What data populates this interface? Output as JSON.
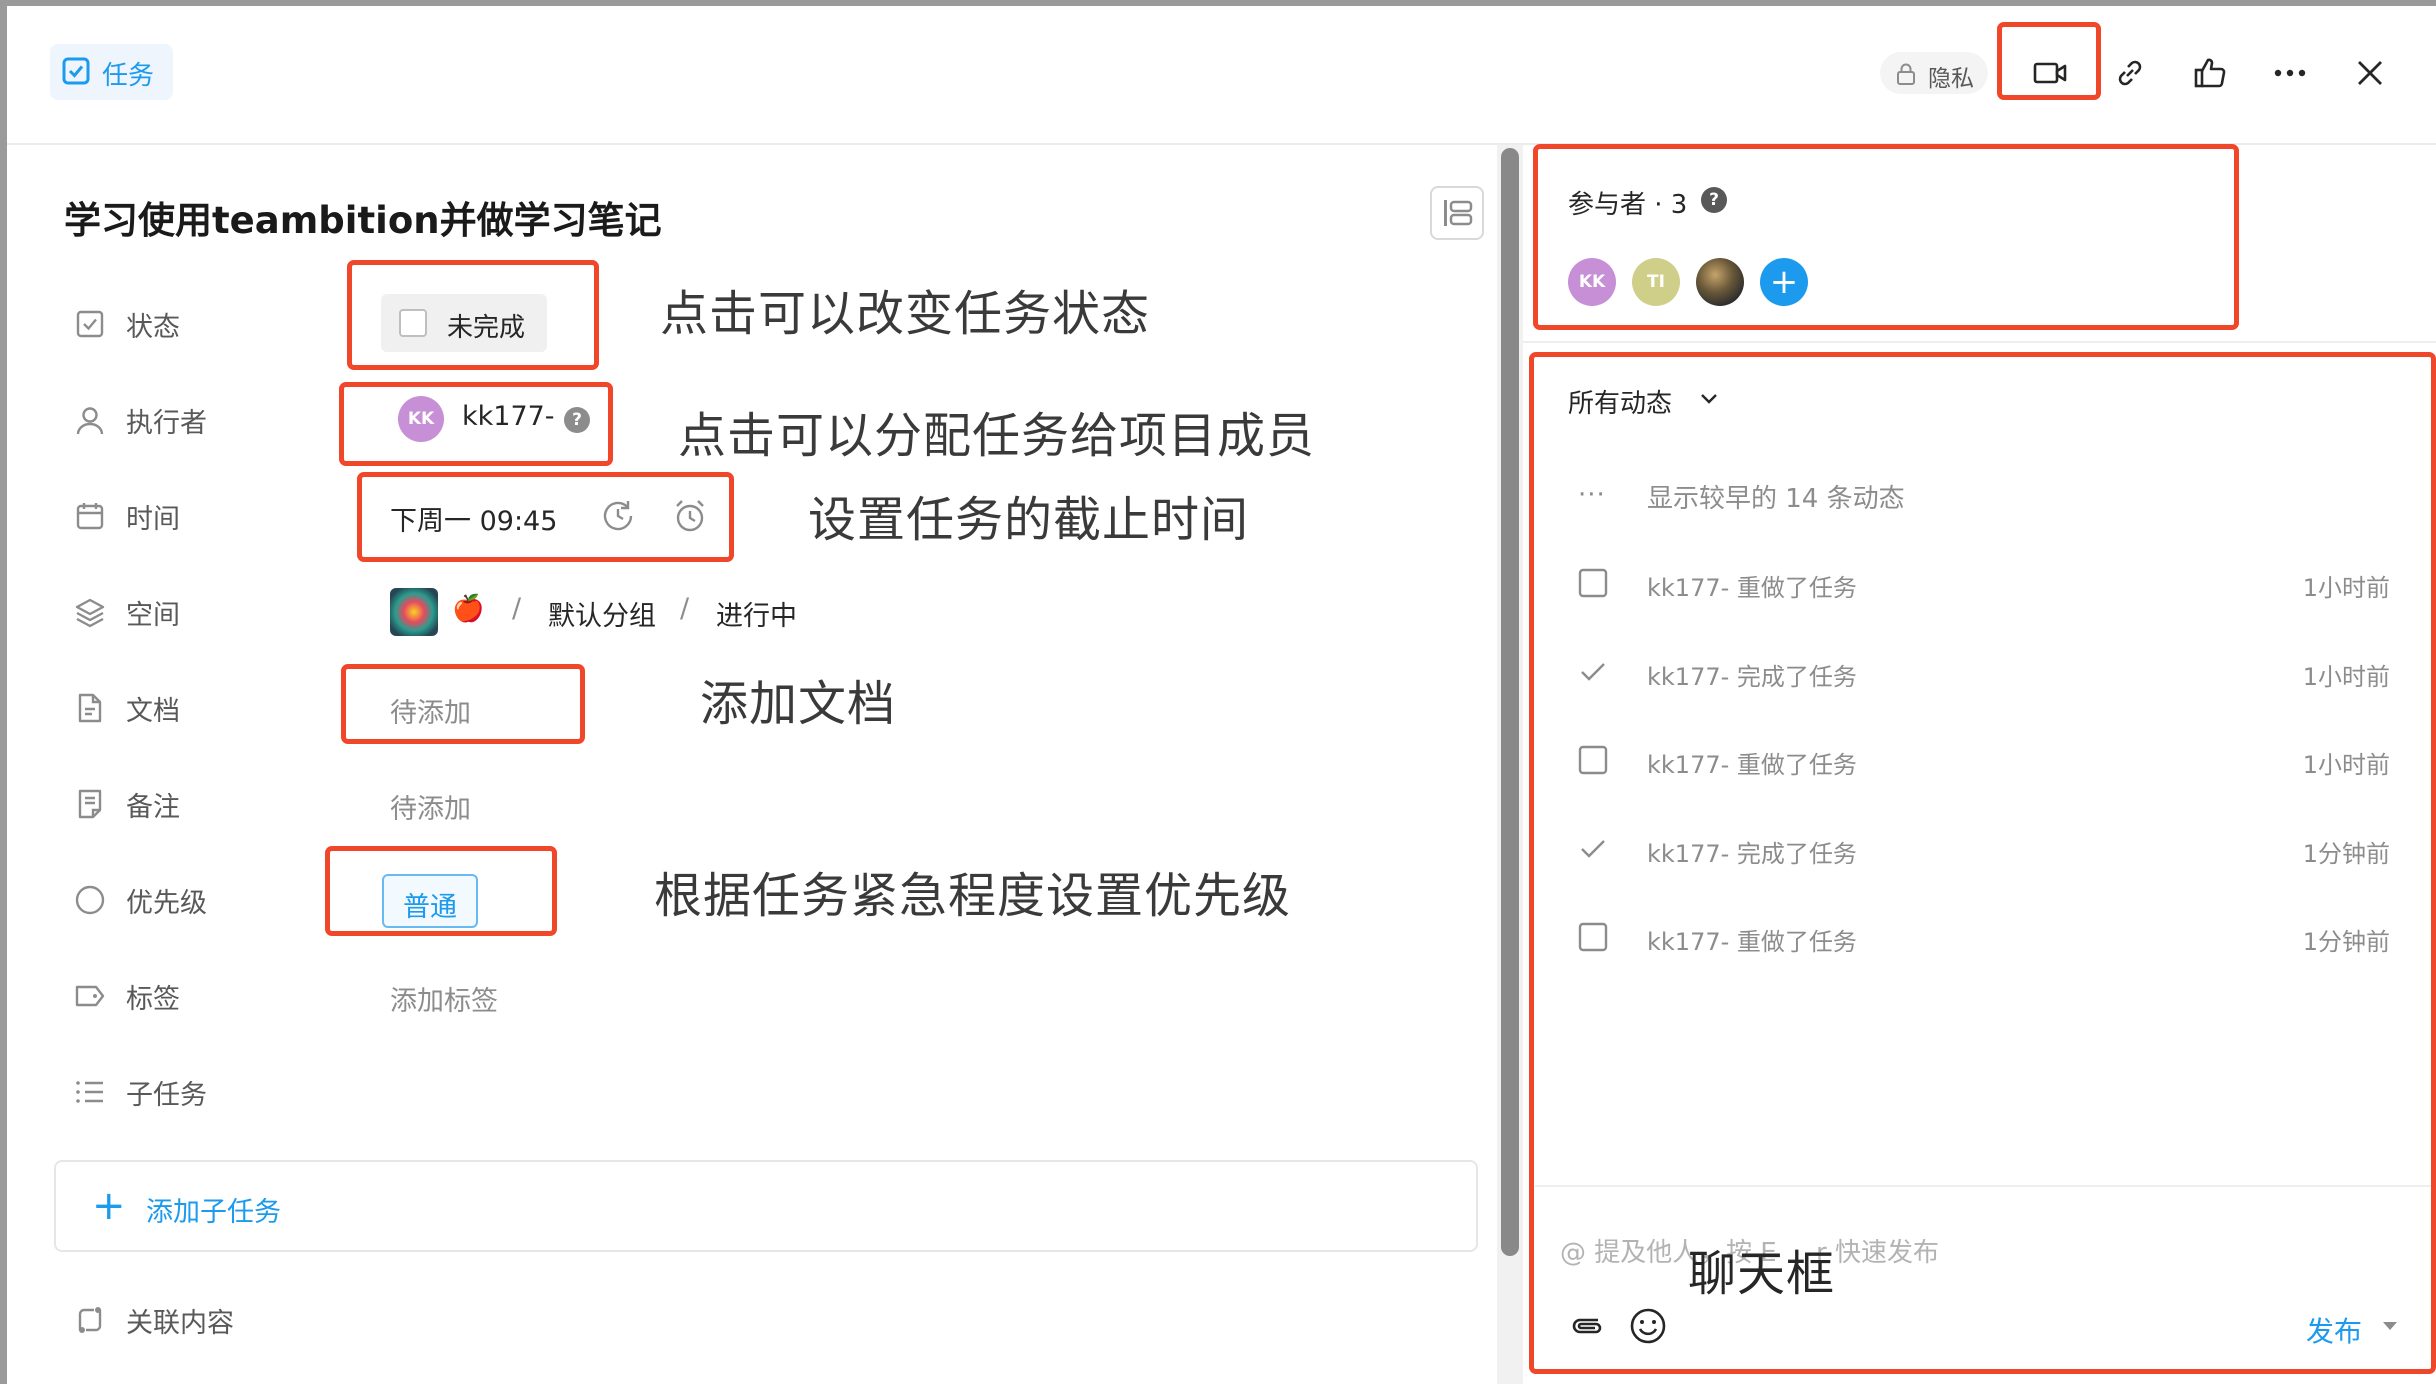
{
  "header": {
    "task_tag": "任务",
    "privacy_label": "隐私",
    "icons": [
      "lock-icon",
      "video-call-icon",
      "link-icon",
      "thumbs-up-icon",
      "more-icon",
      "close-icon"
    ]
  },
  "task": {
    "title": "学习使用teambition并做学习笔记",
    "fields": {
      "status": {
        "label": "状态",
        "value": "未完成"
      },
      "assignee": {
        "label": "执行者",
        "name": "kk177-",
        "avatar_initials": "KK"
      },
      "time": {
        "label": "时间",
        "value": "下周一 09:45"
      },
      "space": {
        "label": "空间",
        "project_emoji": "🍎",
        "sep": "/",
        "group": "默认分组",
        "stage": "进行中"
      },
      "docs": {
        "label": "文档",
        "value": "待添加"
      },
      "notes": {
        "label": "备注",
        "value": "待添加"
      },
      "priority": {
        "label": "优先级",
        "value": "普通"
      },
      "tags": {
        "label": "标签",
        "value": "添加标签"
      },
      "subtasks": {
        "label": "子任务"
      }
    },
    "add_subtask": "添加子任务",
    "related": "关联内容"
  },
  "annotations": {
    "status": "点击可以改变任务状态",
    "assignee": "点击可以分配任务给项目成员",
    "time": "设置任务的截止时间",
    "docs": "添加文档",
    "priority": "根据任务紧急程度设置优先级",
    "chat": "聊天框"
  },
  "participants": {
    "title": "参与者 · 3",
    "avatars": [
      {
        "initials": "KK",
        "color": "#c68fd6"
      },
      {
        "initials": "TI",
        "color": "#cfcf8a"
      },
      {
        "initials": "",
        "color": "#4a4a4a"
      }
    ]
  },
  "activity": {
    "filter_label": "所有动态",
    "show_earlier": "显示较早的 14 条动态",
    "items": [
      {
        "icon": "checkbox",
        "text": "kk177- 重做了任务",
        "time": "1小时前"
      },
      {
        "icon": "check",
        "text": "kk177- 完成了任务",
        "time": "1小时前"
      },
      {
        "icon": "checkbox",
        "text": "kk177- 重做了任务",
        "time": "1小时前"
      },
      {
        "icon": "check",
        "text": "kk177- 完成了任务",
        "time": "1分钟前"
      },
      {
        "icon": "checkbox",
        "text": "kk177- 重做了任务",
        "time": "1分钟前"
      }
    ]
  },
  "composer": {
    "placeholder_left": "@ 提及他人",
    "placeholder_mid": "，按 E",
    "placeholder_right": "r 快速发布",
    "publish": "发布"
  },
  "colors": {
    "accent": "#1b9aee",
    "highlight": "#f0462a"
  }
}
